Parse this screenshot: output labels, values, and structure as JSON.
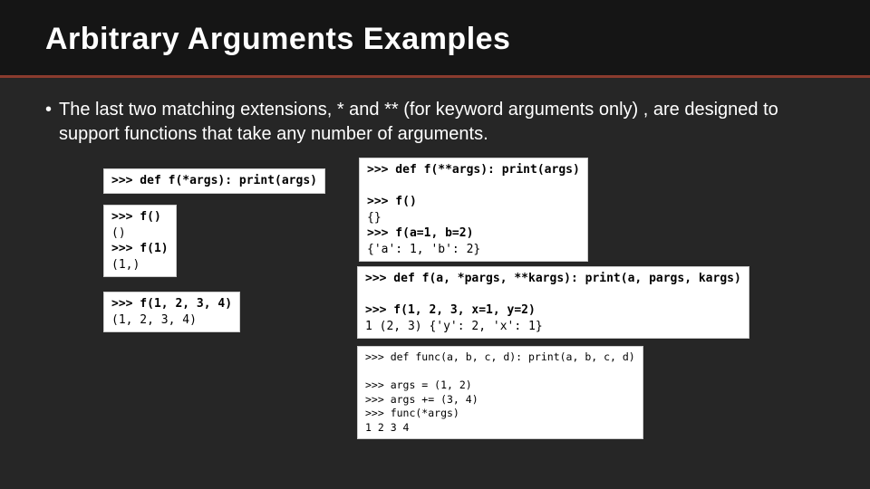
{
  "title": "Arbitrary Arguments Examples",
  "bullet": "The last two matching extensions, * and  ** (for keyword arguments only) , are designed to support functions that take any number of arguments.",
  "snippets": {
    "s1_l1": ">>> def f(*args): print(args)",
    "s2_l1": ">>> f()",
    "s2_l2": "()",
    "s2_l3": ">>> f(1)",
    "s2_l4": "(1,)",
    "s3_l1": ">>> f(1, 2, 3, 4)",
    "s3_l2": "(1, 2, 3, 4)",
    "s4_l1": ">>> def f(**args): print(args)",
    "s4_l2": "",
    "s4_l3": ">>> f()",
    "s4_l4": "{}",
    "s4_l5": ">>> f(a=1, b=2)",
    "s4_l6": "{'a': 1, 'b': 2}",
    "s5_l1": ">>> def f(a, *pargs, **kargs): print(a, pargs, kargs)",
    "s5_l2": "",
    "s5_l3": ">>> f(1, 2, 3, x=1, y=2)",
    "s5_l4": "1 (2, 3) {'y': 2, 'x': 1}",
    "s6_l1": ">>> def func(a, b, c, d): print(a, b, c, d)",
    "s6_l2": "",
    "s6_l3": ">>> args = (1, 2)",
    "s6_l4": ">>> args += (3, 4)",
    "s6_l5": ">>> func(*args)",
    "s6_l6": "1 2 3 4"
  }
}
